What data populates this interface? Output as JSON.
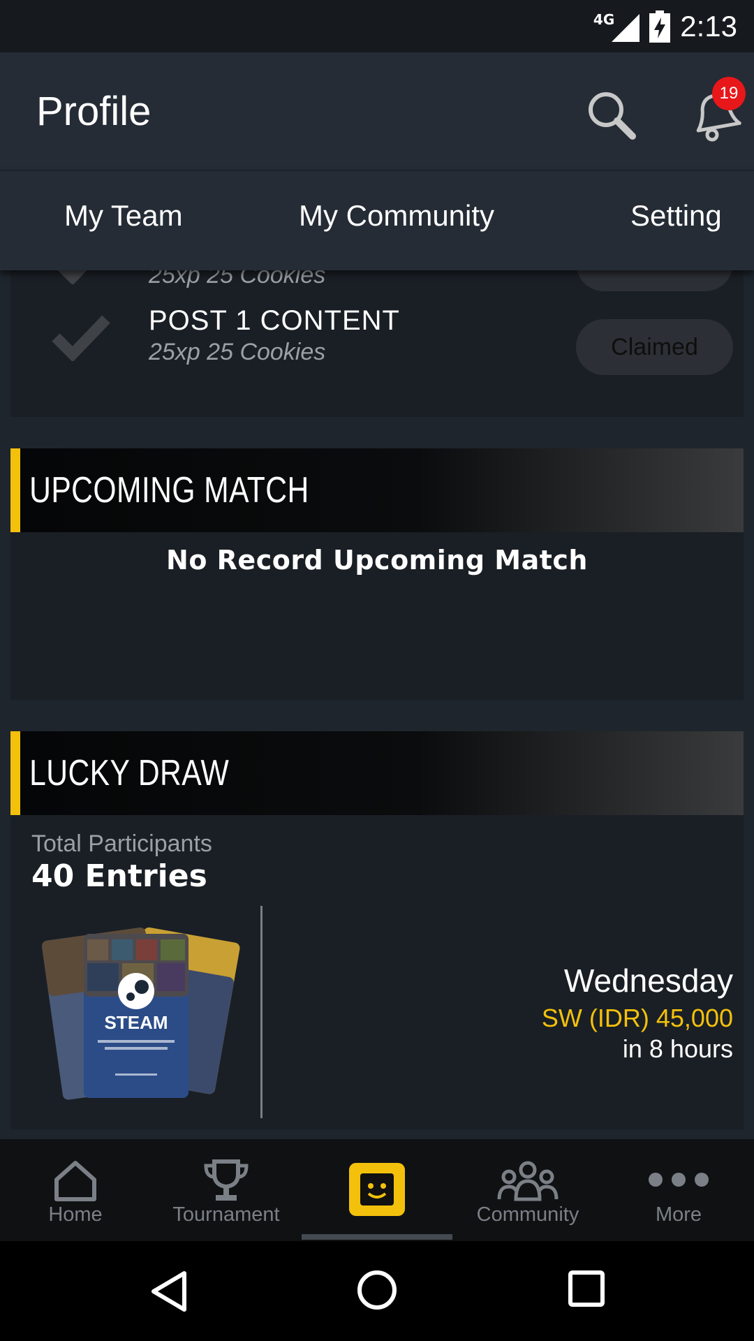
{
  "status_bar": {
    "network": "4G",
    "time": "2:13"
  },
  "app_bar": {
    "title": "Profile",
    "notification_count": "19"
  },
  "tabs": [
    {
      "label": "My Team"
    },
    {
      "label": "My Community"
    },
    {
      "label": "Setting"
    }
  ],
  "tasks": [
    {
      "name": "",
      "reward": "25xp 25 Cookies",
      "status": ""
    },
    {
      "name": "POST 1 CONTENT",
      "reward": "25xp 25 Cookies",
      "status": "Claimed"
    }
  ],
  "upcoming_match": {
    "title": "UPCOMING MATCH",
    "empty_text": "No Record Upcoming Match"
  },
  "lucky_draw": {
    "title": "LUCKY DRAW",
    "participants_label": "Total Participants",
    "participants_count": "40 Entries",
    "card_brand": "STEAM",
    "day": "Wednesday",
    "prize": "SW (IDR) 45,000",
    "time_left": "in 8 hours"
  },
  "bottom_nav": [
    {
      "label": "Home",
      "icon": "home-icon"
    },
    {
      "label": "Tournament",
      "icon": "trophy-icon"
    },
    {
      "label": "",
      "icon": "smiley-icon"
    },
    {
      "label": "Community",
      "icon": "people-icon"
    },
    {
      "label": "More",
      "icon": "more-dots-icon"
    }
  ],
  "colors": {
    "accent": "#f3c10c",
    "badge": "#e8171a",
    "background": "#1e252d"
  }
}
